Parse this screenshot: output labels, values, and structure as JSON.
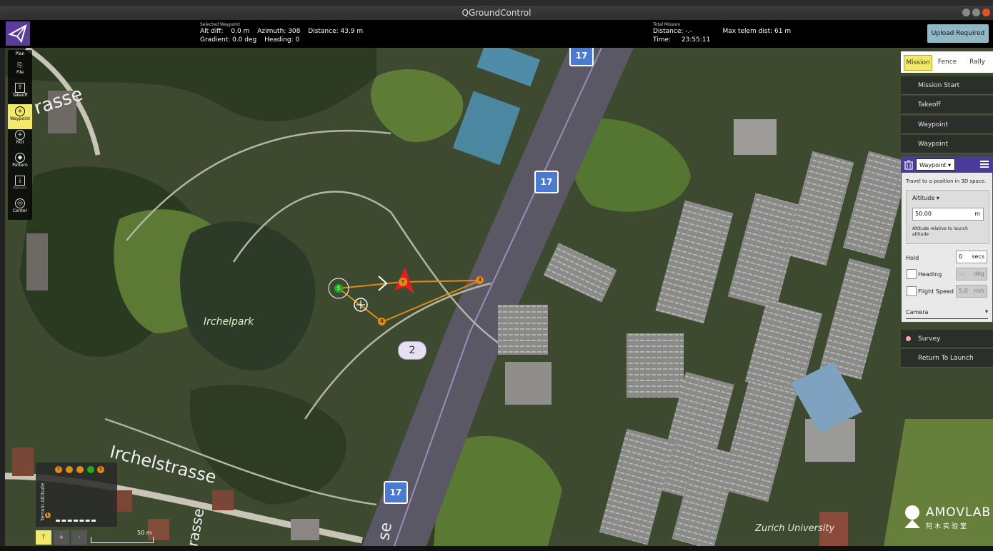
{
  "window": {
    "title": "QGroundControl"
  },
  "toolbar": {
    "selected_waypoint": {
      "header": "Selected Waypoint",
      "alt_diff_label": "Alt diff:",
      "alt_diff_value": "0.0 m",
      "azimuth_label": "Azimuth:",
      "azimuth_value": "308",
      "distance_label": "Distance:",
      "distance_value": "43.9 m",
      "gradient_label": "Gradient:",
      "gradient_value": "0.0 deg",
      "heading_label": "Heading:",
      "heading_value": "0"
    },
    "total_mission": {
      "header": "Total Mission",
      "distance_label": "Distance:",
      "distance_value": "-.-",
      "max_telem_label": "Max telem dist:",
      "max_telem_value": "61 m",
      "time_label": "Time:",
      "time_value": "23:55:11"
    },
    "upload_label": "Upload Required"
  },
  "tools": [
    {
      "label": "Plan",
      "icon": "plan-icon"
    },
    {
      "label": "File",
      "icon": "file-icon"
    },
    {
      "label": "Takeoff",
      "icon": "takeoff-icon"
    },
    {
      "label": "Waypoint",
      "icon": "waypoint-icon",
      "active": true
    },
    {
      "label": "ROI",
      "icon": "roi-icon"
    },
    {
      "label": "Pattern",
      "icon": "pattern-icon"
    },
    {
      "label": "Return",
      "icon": "return-icon"
    },
    {
      "label": "Center",
      "icon": "center-icon"
    }
  ],
  "panel": {
    "tabs": [
      "Mission",
      "Fence",
      "Rally"
    ],
    "items_top": [
      "Mission Start",
      "Takeoff",
      "Waypoint",
      "Waypoint"
    ],
    "editor": {
      "type": "Waypoint",
      "description": "Travel to a position in 3D space.",
      "altitude_label": "Altitude",
      "altitude_value": "50.00",
      "altitude_unit": "m",
      "altitude_note": "Altitude relative to launch altitude",
      "hold_label": "Hold",
      "hold_value": "0",
      "hold_unit": "secs",
      "heading_label": "Heading",
      "heading_value": "-.-",
      "heading_unit": "deg",
      "speed_label": "Flight Speed",
      "speed_value": "5.0",
      "speed_unit": "m/s",
      "camera_label": "Camera"
    },
    "items_bottom": [
      "Survey",
      "Return To Launch"
    ]
  },
  "map": {
    "labels": {
      "strasse_top": "rasse",
      "park": "Irchelpark",
      "street": "Irchelstrasse",
      "street_vertical": "rasse",
      "se": "se",
      "campus": "Zurich University"
    },
    "shields": [
      "17",
      "17",
      "17"
    ],
    "bubble": "2",
    "waypoints": [
      "5",
      "T",
      "3",
      "4"
    ]
  },
  "terrain": {
    "axis_label": "Terrain Altitude",
    "dots": [
      "T",
      "",
      "",
      "",
      "5"
    ],
    "launch": "L",
    "buttons": [
      "T",
      "+",
      "-"
    ],
    "scale": "50 m"
  },
  "watermark": {
    "main": "AMOVLAB",
    "sub": "阿木实验室"
  }
}
